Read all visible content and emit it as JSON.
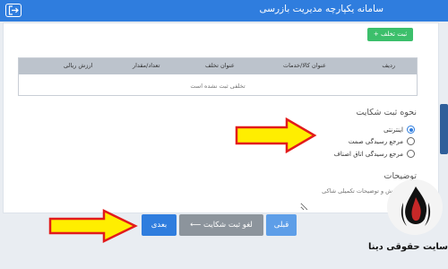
{
  "header": {
    "title": "سامانه یکپارچه مدیریت بازرسی",
    "logout_icon": "logout-icon"
  },
  "violations": {
    "add_label": "ثبت تخلف +",
    "columns": [
      "ردیف",
      "عنوان کالا/خدمات",
      "عنوان تخلف",
      "تعداد/مقدار",
      "ارزش ریالی"
    ],
    "empty_text": "تخلفی ثبت نشده است"
  },
  "complaint_method": {
    "title": "نحوه ثبت شکایت",
    "options": [
      {
        "label": "اینترنتی",
        "checked": true
      },
      {
        "label": "مرجع رسیدگی صمت",
        "checked": false
      },
      {
        "label": "مرجع رسیدگی اتاق اصناف",
        "checked": false
      }
    ]
  },
  "description": {
    "title": "توضیحات",
    "placeholder": "شرح گزارش و توضیحات تکمیلی شاکی"
  },
  "footer": {
    "next_label": "بعدی",
    "cancel_label": "لغو ثبت شکایت",
    "prev_label": "قبلی"
  },
  "watermark": {
    "text": "سایت حقوقی دینا"
  },
  "colors": {
    "primary": "#2f7dde",
    "success": "#3cbf6b",
    "arrow_fill": "#ffee00",
    "arrow_stroke": "#e21b1b"
  }
}
